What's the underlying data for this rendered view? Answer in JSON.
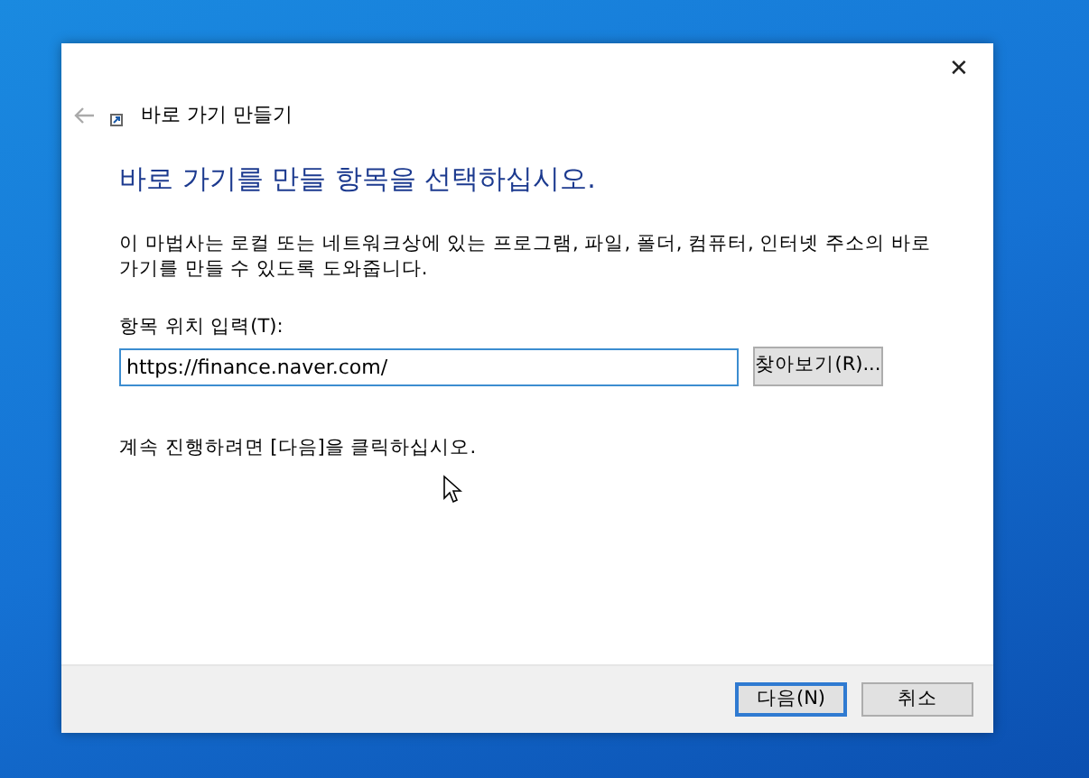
{
  "window": {
    "title": "바로 가기 만들기",
    "close": "✕"
  },
  "heading": "바로 가기를 만들 항목을 선택하십시오.",
  "description": "이 마법사는 로컬 또는 네트워크상에 있는 프로그램, 파일, 폴더, 컴퓨터, 인터넷 주소의 바로 가기를 만들 수 있도록 도와줍니다.",
  "location": {
    "label": "항목 위치 입력(T):",
    "value": "https://finance.naver.com/",
    "browse": "찾아보기(R)..."
  },
  "hint": "계속 진행하려면 [다음]을 클릭하십시오.",
  "buttons": [
    {
      "label": "다음(N)",
      "default": true
    },
    {
      "label": "취소",
      "default": false
    }
  ]
}
